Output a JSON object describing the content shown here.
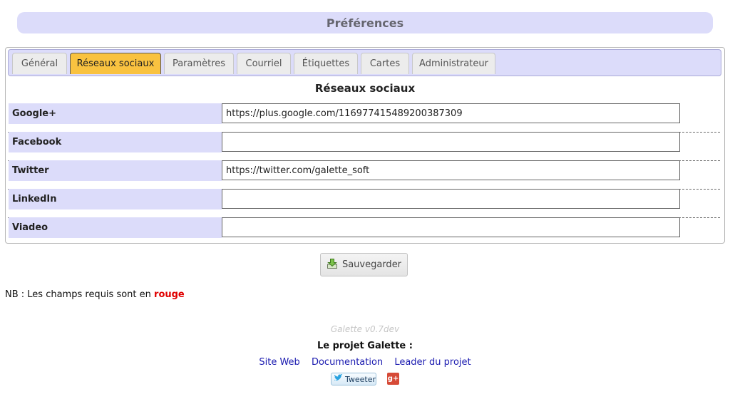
{
  "header": {
    "title": "Préférences"
  },
  "tabs": [
    {
      "label": "Général",
      "active": false
    },
    {
      "label": "Réseaux sociaux",
      "active": true
    },
    {
      "label": "Paramètres",
      "active": false
    },
    {
      "label": "Courriel",
      "active": false
    },
    {
      "label": "Étiquettes",
      "active": false
    },
    {
      "label": "Cartes",
      "active": false
    },
    {
      "label": "Administrateur",
      "active": false
    }
  ],
  "section": {
    "title": "Réseaux sociaux"
  },
  "fields": [
    {
      "label": "Google+",
      "value": "https://plus.google.com/116977415489200387309"
    },
    {
      "label": "Facebook",
      "value": ""
    },
    {
      "label": "Twitter",
      "value": "https://twitter.com/galette_soft"
    },
    {
      "label": "LinkedIn",
      "value": ""
    },
    {
      "label": "Viadeo",
      "value": ""
    }
  ],
  "save_button": {
    "label": "Sauvegarder",
    "icon": "save-download-icon"
  },
  "note": {
    "prefix": "NB : Les champs requis sont en",
    "highlight": "rouge",
    "highlight_color": "#e00000"
  },
  "footer": {
    "version": "Galette v0.7dev",
    "project_title": "Le projet Galette :",
    "links": [
      "Site Web",
      "Documentation",
      "Leader du projet"
    ],
    "tweet_label": "Tweeter",
    "gplus_label": "g+"
  },
  "colors": {
    "tab_active": "#f9c240",
    "header_bg": "#dcdcfa",
    "link": "#1b1bb0"
  }
}
